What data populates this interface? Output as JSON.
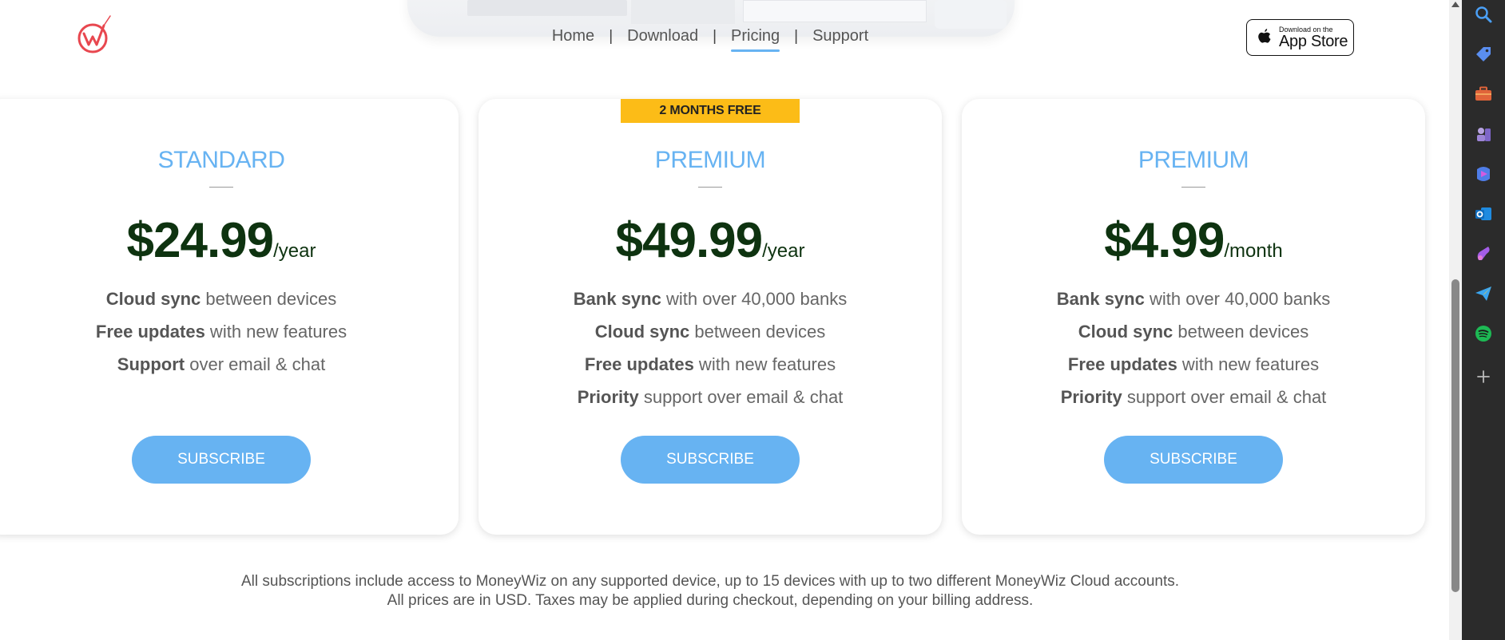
{
  "nav": {
    "items": [
      {
        "label": "Home"
      },
      {
        "label": "Download"
      },
      {
        "label": "Pricing",
        "active": true
      },
      {
        "label": "Support"
      }
    ],
    "separator": "|"
  },
  "app_store": {
    "small": "Download on the",
    "big": "App Store"
  },
  "plans": [
    {
      "name": "STANDARD",
      "price": "$24.99",
      "period": "/year",
      "features": [
        {
          "bold": "Cloud sync",
          "rest": " between devices"
        },
        {
          "bold": "Free updates",
          "rest": " with new features"
        },
        {
          "bold": "Support",
          "rest": " over email & chat"
        }
      ],
      "button": "SUBSCRIBE"
    },
    {
      "ribbon": "2 MONTHS FREE",
      "name": "PREMIUM",
      "price": "$49.99",
      "period": "/year",
      "features": [
        {
          "bold": "Bank sync",
          "rest": " with over 40,000 banks"
        },
        {
          "bold": "Cloud sync",
          "rest": " between devices"
        },
        {
          "bold": "Free updates",
          "rest": " with new features"
        },
        {
          "bold": "Priority",
          "rest": " support over email & chat"
        }
      ],
      "button": "SUBSCRIBE"
    },
    {
      "name": "PREMIUM",
      "price": "$4.99",
      "period": "/month",
      "features": [
        {
          "bold": "Bank sync",
          "rest": " with over 40,000 banks"
        },
        {
          "bold": "Cloud sync",
          "rest": " between devices"
        },
        {
          "bold": "Free updates",
          "rest": " with new features"
        },
        {
          "bold": "Priority",
          "rest": " support over email & chat"
        }
      ],
      "button": "SUBSCRIBE"
    }
  ],
  "footnotes": [
    "All subscriptions include access to MoneyWiz on any supported device, up to 15 devices with up to two different MoneyWiz Cloud accounts.",
    "All prices are in USD. Taxes may be applied during checkout, depending on your billing address."
  ],
  "colors": {
    "accent": "#67b3f2",
    "ribbon": "#fcbc17",
    "price": "#0e3310",
    "logo": "#e8474f",
    "sidebar_bg": "#2b2b2b"
  },
  "sidebar_icons": [
    "search-icon",
    "tag-icon",
    "briefcase-icon",
    "chess-icon",
    "copilot-icon",
    "outlook-icon",
    "designer-icon",
    "send-icon",
    "spotify-icon",
    "plus-icon"
  ]
}
